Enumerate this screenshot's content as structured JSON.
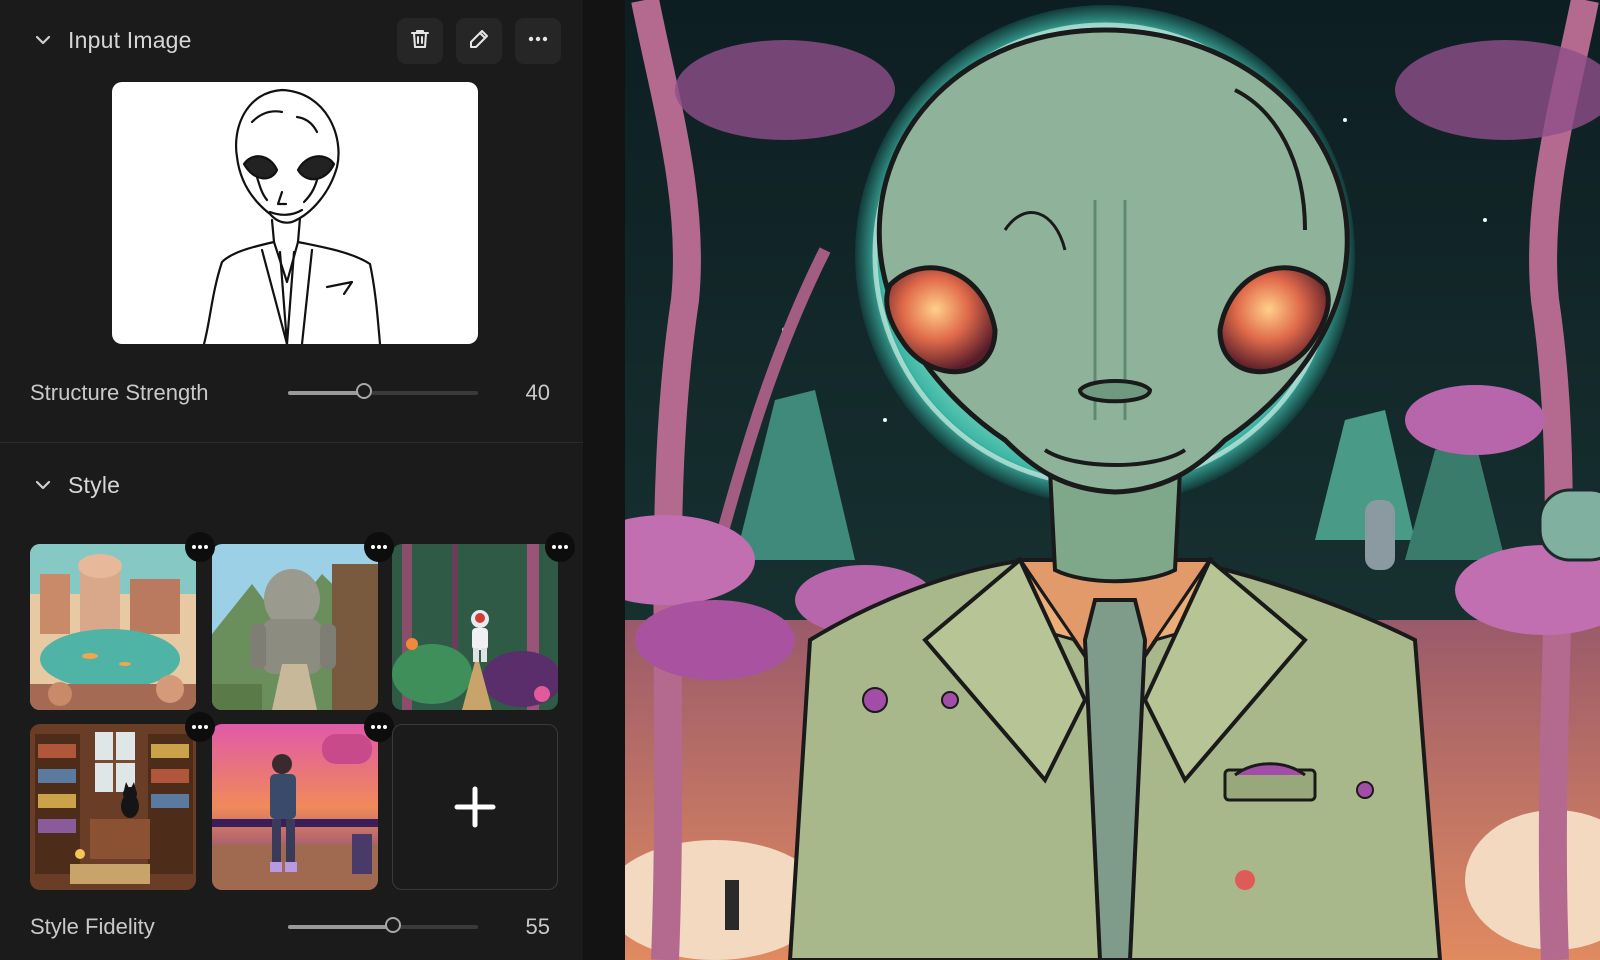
{
  "input_section": {
    "title": "Input Image",
    "icons": {
      "collapse": "chevron-down-icon",
      "delete": "trash-icon",
      "edit": "pencil-icon",
      "more": "more-horizontal-icon"
    }
  },
  "structure_strength": {
    "label": "Structure Strength",
    "value": "40",
    "fraction": 0.4
  },
  "style_section": {
    "title": "Style",
    "tiles": [
      {
        "name": "futuristic-city-pond"
      },
      {
        "name": "stone-golem-canyon"
      },
      {
        "name": "astronaut-jungle"
      },
      {
        "name": "library-cat"
      },
      {
        "name": "synthwave-warrior"
      }
    ],
    "add_icon": "plus-icon"
  },
  "style_fidelity": {
    "label": "Style Fidelity",
    "value": "55",
    "fraction": 0.55
  },
  "colors": {
    "panel_bg": "#1b1b1b",
    "accent_alien": "#8fb39a",
    "moon_glow": "#5fd6c0",
    "forest_purple": "#a262b8"
  }
}
